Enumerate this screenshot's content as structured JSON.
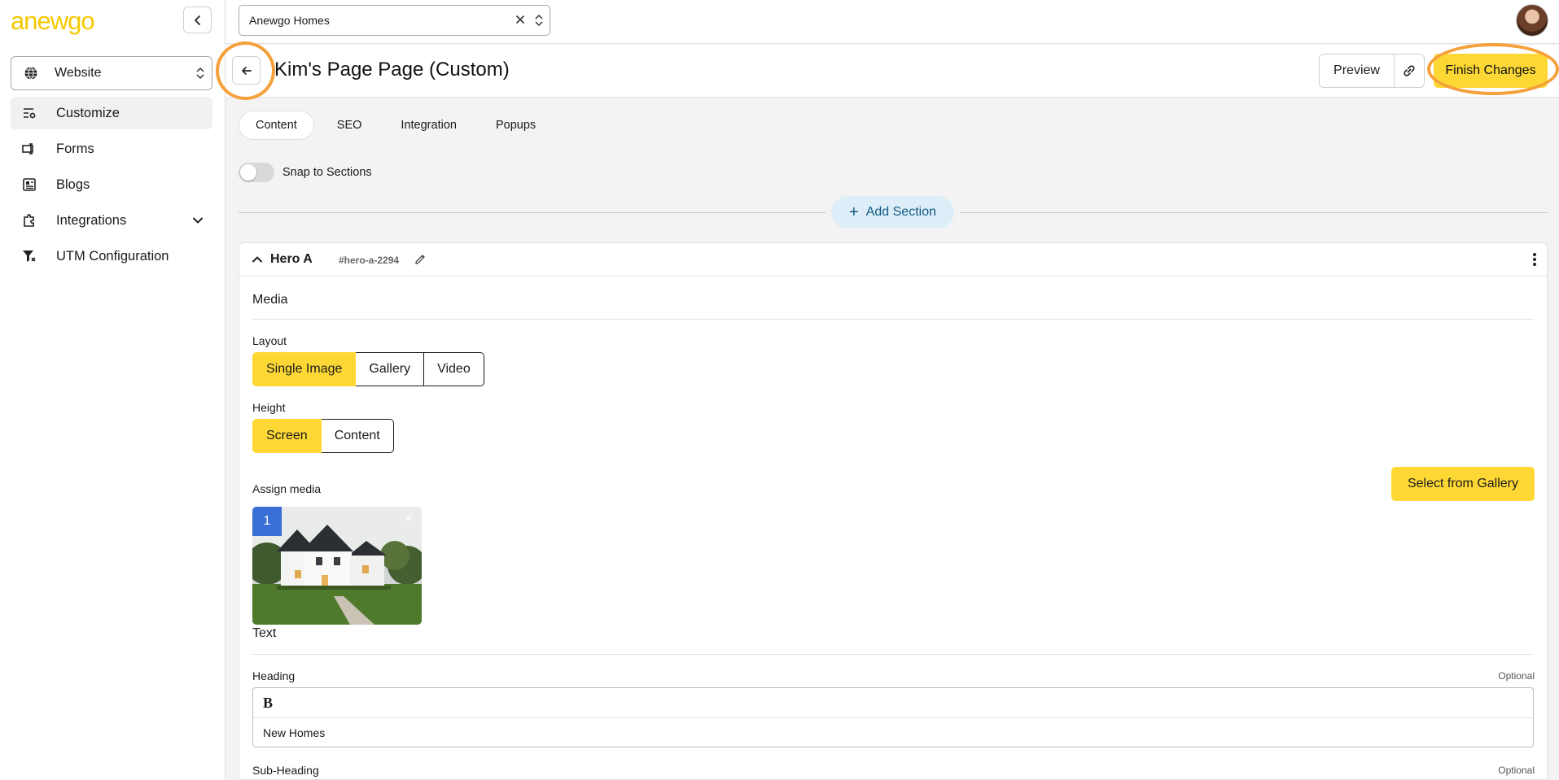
{
  "brand": {
    "logo_text": "anewgo",
    "accent_color": "#fdd835",
    "ring_color": "#f5a03a",
    "badge_color": "#3a6fd8"
  },
  "sidebar": {
    "site_select": {
      "label": "Website",
      "icon": "globe-icon"
    },
    "items": [
      {
        "label": "Customize",
        "icon": "sliders-icon",
        "active": true
      },
      {
        "label": "Forms",
        "icon": "form-icon"
      },
      {
        "label": "Blogs",
        "icon": "newspaper-icon"
      },
      {
        "label": "Integrations",
        "icon": "puzzle-icon",
        "expandable": true
      },
      {
        "label": "UTM Configuration",
        "icon": "filter-icon"
      }
    ]
  },
  "topbar": {
    "account": "Anewgo Homes"
  },
  "header": {
    "title": "Kim's Page Page (Custom)",
    "preview_label": "Preview",
    "finish_label": "Finish Changes"
  },
  "tabs": [
    "Content",
    "SEO",
    "Integration",
    "Popups"
  ],
  "snap_label": "Snap to Sections",
  "add_section_label": "Add Section",
  "section": {
    "name": "Hero A",
    "anchor": "#hero-a-2294",
    "media_heading": "Media",
    "layout_label": "Layout",
    "layout_options": [
      "Single Image",
      "Gallery",
      "Video"
    ],
    "layout_selected": "Single Image",
    "height_label": "Height",
    "height_options": [
      "Screen",
      "Content"
    ],
    "height_selected": "Screen",
    "assign_media_label": "Assign media",
    "gallery_button": "Select from Gallery",
    "media_index": "1",
    "text_heading": "Text",
    "heading_label": "Heading",
    "optional_label": "Optional",
    "bold_button": "B",
    "heading_value": "New Homes",
    "subheading_label": "Sub-Heading"
  }
}
